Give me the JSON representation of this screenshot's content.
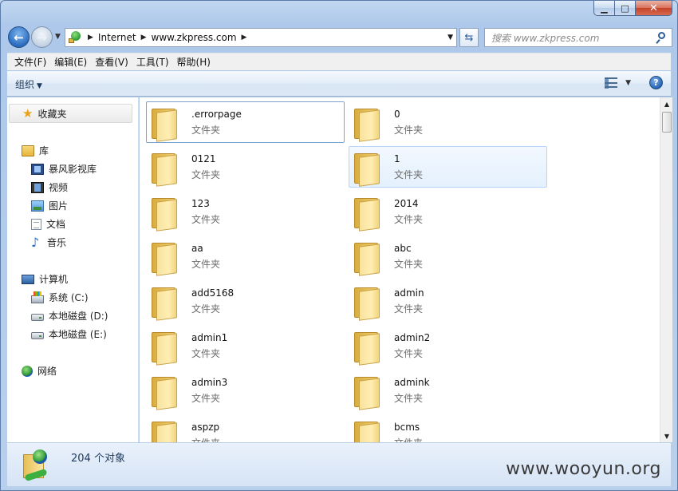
{
  "window": {
    "caption": {
      "minimize": "▁",
      "maximize": "□",
      "close": "✕"
    }
  },
  "nav": {
    "back_glyph": "←",
    "forward_glyph": "→",
    "address": {
      "crumbs": [
        "Internet",
        "www.zkpress.com"
      ]
    },
    "search_placeholder": "搜索 www.zkpress.com"
  },
  "menubar": [
    "文件(F)",
    "编辑(E)",
    "查看(V)",
    "工具(T)",
    "帮助(H)"
  ],
  "toolbar": {
    "organize_label": "组织",
    "help_label": "?"
  },
  "sidebar": {
    "favorites": "收藏夹",
    "libraries": {
      "label": "库",
      "items": [
        "暴风影视库",
        "视频",
        "图片",
        "文档",
        "音乐"
      ]
    },
    "computer": {
      "label": "计算机",
      "items": [
        "系统 (C:)",
        "本地磁盘 (D:)",
        "本地磁盘 (E:)"
      ]
    },
    "network": "网络"
  },
  "folders": [
    {
      "name": ".errorpage",
      "type": "文件夹"
    },
    {
      "name": "0",
      "type": "文件夹"
    },
    {
      "name": "0121",
      "type": "文件夹"
    },
    {
      "name": "1",
      "type": "文件夹"
    },
    {
      "name": "123",
      "type": "文件夹"
    },
    {
      "name": "2014",
      "type": "文件夹"
    },
    {
      "name": "aa",
      "type": "文件夹"
    },
    {
      "name": "abc",
      "type": "文件夹"
    },
    {
      "name": "add5168",
      "type": "文件夹"
    },
    {
      "name": "admin",
      "type": "文件夹"
    },
    {
      "name": "admin1",
      "type": "文件夹"
    },
    {
      "name": "admin2",
      "type": "文件夹"
    },
    {
      "name": "admin3",
      "type": "文件夹"
    },
    {
      "name": "admink",
      "type": "文件夹"
    },
    {
      "name": "aspzp",
      "type": "文件夹"
    },
    {
      "name": "bcms",
      "type": "文件夹"
    }
  ],
  "details": {
    "count": "204 个对象"
  },
  "watermark": "www.wooyun.org"
}
